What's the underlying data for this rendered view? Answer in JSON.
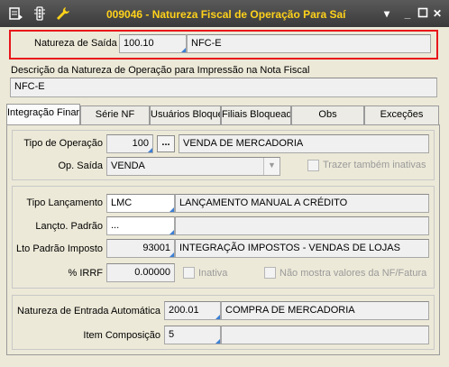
{
  "window": {
    "title": "009046 - Natureza Fiscal de Operação Para Saí",
    "colors": {
      "title_text": "#ffd21a",
      "highlight": "#e8151b",
      "accent_corner": "#3c7fd6"
    }
  },
  "header": {
    "natureza_saida_label": "Natureza de Saída",
    "natureza_saida_code": "100.10",
    "natureza_saida_desc": "NFC-E"
  },
  "descricao": {
    "label": "Descrição da Natureza de Operação para Impressão na Nota Fiscal",
    "value": "NFC-E"
  },
  "tabs": [
    {
      "label": "Integração Finar"
    },
    {
      "label": "Série NF"
    },
    {
      "label": "Usuários Bloque"
    },
    {
      "label": "Filiais Bloquead"
    },
    {
      "label": "Obs"
    },
    {
      "label": "Exceções"
    }
  ],
  "operacao": {
    "tipo_label": "Tipo de Operação",
    "tipo_code": "100",
    "tipo_button": "...",
    "tipo_desc": "VENDA DE MERCADORIA",
    "op_saida_label": "Op. Saída",
    "op_saida_value": "VENDA",
    "trazer_inativas_label": "Trazer também inativas"
  },
  "lancamento": {
    "tipo_label": "Tipo Lançamento",
    "tipo_code": "LMC",
    "tipo_desc": "LANÇAMENTO MANUAL A CRÉDITO",
    "padrao_label": "Lançto. Padrão",
    "padrao_code": "...",
    "padrao_desc": "",
    "lto_imposto_label": "Lto Padrão Imposto",
    "lto_imposto_code": "93001",
    "lto_imposto_desc": "INTEGRAÇÃO IMPOSTOS - VENDAS DE LOJAS",
    "irrf_label": "% IRRF",
    "irrf_value": "0.00000",
    "inativa_label": "Inativa",
    "nao_mostra_label": "Não mostra valores da NF/Fatura"
  },
  "entrada": {
    "natureza_label": "Natureza de Entrada Automática",
    "natureza_code": "200.01",
    "natureza_desc": "COMPRA DE MERCADORIA",
    "item_label": "Item Composição",
    "item_code": "5",
    "item_desc": ""
  }
}
